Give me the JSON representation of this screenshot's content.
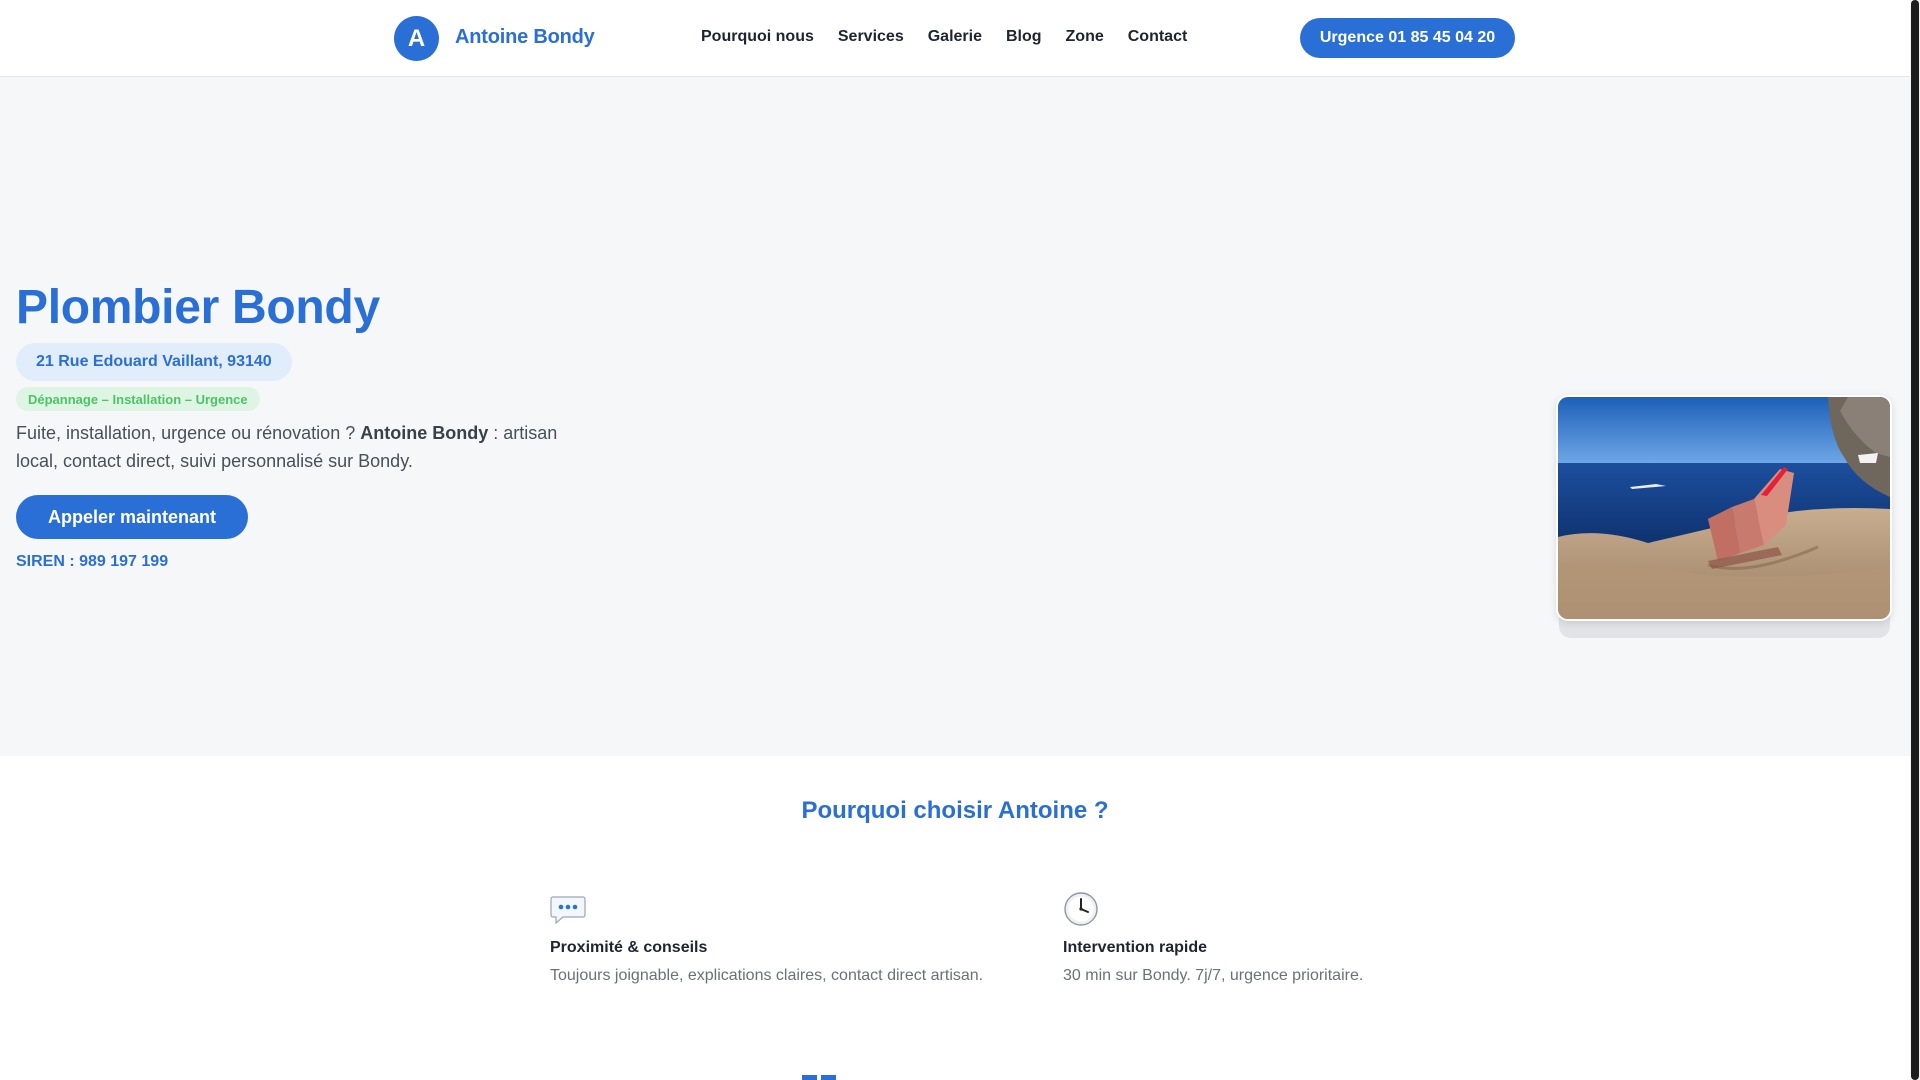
{
  "header": {
    "logo_letter": "A",
    "brand": "Antoine Bondy",
    "nav": [
      "Pourquoi nous",
      "Services",
      "Galerie",
      "Blog",
      "Zone",
      "Contact"
    ],
    "urgence": "Urgence 01 85 45 04 20"
  },
  "hero": {
    "title": "Plombier Bondy",
    "address": "21 Rue Edouard Vaillant, 93140",
    "services_tag": "Dépannage – Installation – Urgence",
    "desc_before": "Fuite, installation, urgence ou rénovation ? ",
    "desc_strong": "Antoine Bondy",
    "desc_after": " : artisan local, contact direct, suivi personnalisé sur Bondy.",
    "cta": "Appeler maintenant",
    "siren": "SIREN : 989 197 199",
    "photo_icon": "armchair-on-rocky-coast-photo"
  },
  "why": {
    "title": "Pourquoi choisir Antoine ?",
    "features": [
      {
        "icon": "speech-bubble-icon",
        "title": "Proximité & conseils",
        "text": "Toujours joignable, explications claires, contact direct artisan."
      },
      {
        "icon": "clock-icon",
        "title": "Intervention rapide",
        "text": "30 min sur Bondy. 7j/7, urgence prioritaire."
      }
    ]
  },
  "colors": {
    "accent": "#2a6fd6",
    "hero_bg": "#f6f7f9",
    "green_tag": "#4cc466"
  }
}
